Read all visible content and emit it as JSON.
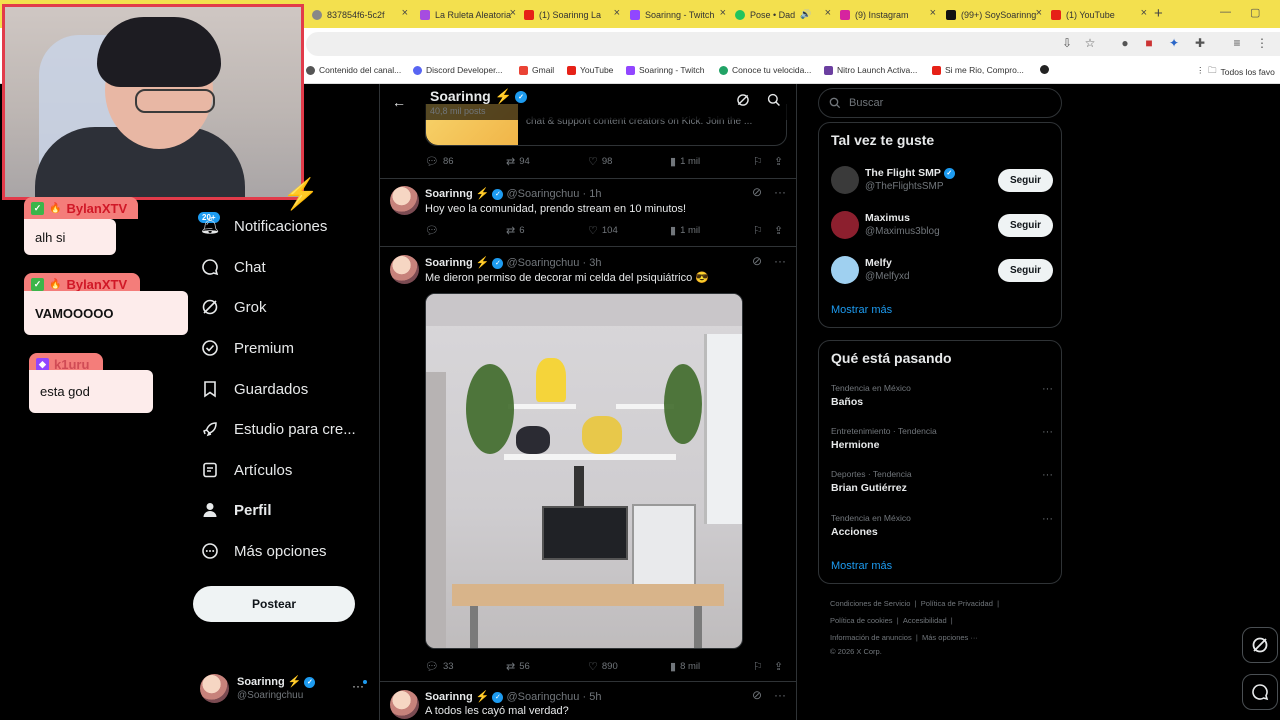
{
  "browser": {
    "tabs": [
      {
        "title": "837854f6-5c2f",
        "color": "#888"
      },
      {
        "title": "La Ruleta Aleatoria",
        "color": "#a64ce0"
      },
      {
        "title": "(1) Soarinng La",
        "color": "#e62117"
      },
      {
        "title": "Soarinng - Twitch",
        "color": "#9146ff"
      },
      {
        "title": "Pose • Dad",
        "color": "#21c45d"
      },
      {
        "title": "(9) Instagram",
        "color": "#d6249f"
      },
      {
        "title": "(99+) SoySoarinng",
        "color": "#111"
      },
      {
        "title": "(1) YouTube",
        "color": "#e62117"
      }
    ],
    "bookmarks": [
      {
        "label": "Contenido del canal...",
        "color": "#555"
      },
      {
        "label": "Discord Developer...",
        "color": "#5865f2"
      },
      {
        "label": "Gmail",
        "color": "#ea4335"
      },
      {
        "label": "YouTube",
        "color": "#e62117"
      },
      {
        "label": "Soarinng - Twitch",
        "color": "#9146ff"
      },
      {
        "label": "Conoce tu velocida...",
        "color": "#21a366"
      },
      {
        "label": "Nitro Launch Activa...",
        "color": "#6b3fa0"
      },
      {
        "label": "Si me Rio, Compro...",
        "color": "#e62117"
      },
      {
        "label": "",
        "color": "#222"
      }
    ],
    "all_bookmarks": "Todos los favo"
  },
  "chat": [
    {
      "user": "BylanXTV",
      "text": "alh si"
    },
    {
      "user": "BylanXTV",
      "text": "VAMOOOOO"
    },
    {
      "user": "k1uru",
      "text": "esta god"
    }
  ],
  "nav": {
    "badge": "20+",
    "items": [
      {
        "label": "Notificaciones",
        "icon": "bell-icon"
      },
      {
        "label": "Chat",
        "icon": "chat-icon"
      },
      {
        "label": "Grok",
        "icon": "grok-icon"
      },
      {
        "label": "Premium",
        "icon": "premium-icon"
      },
      {
        "label": "Guardados",
        "icon": "bookmark-icon"
      },
      {
        "label": "Estudio para cre...",
        "icon": "rocket-icon"
      },
      {
        "label": "Artículos",
        "icon": "articles-icon"
      },
      {
        "label": "Perfil",
        "icon": "person-icon"
      },
      {
        "label": "Más opciones",
        "icon": "more-circle-icon"
      }
    ],
    "post_button": "Postear",
    "account": {
      "name": "Soarinng ⚡",
      "handle": "@Soaringchuu"
    }
  },
  "timeline": {
    "header": {
      "name": "Soarinng ⚡",
      "posts": "40,8 mil posts"
    },
    "partial_card_text": "chat & support content creators on Kick. Join the ...",
    "partial_actions": {
      "replies": "86",
      "reposts": "94",
      "likes": "98",
      "views": "1 mil"
    },
    "tweets": [
      {
        "name": "Soarinng ⚡",
        "handle": "@Soaringchuu",
        "time": "· 1h",
        "text": "Hoy veo la comunidad, prendo stream en 10 minutos!",
        "replies": "",
        "reposts": "6",
        "likes": "104",
        "views": "1 mil"
      },
      {
        "name": "Soarinng ⚡",
        "handle": "@Soaringchuu",
        "time": "· 3h",
        "text": "Me dieron permiso de decorar mi celda del psiquiátrico 😎",
        "replies": "33",
        "reposts": "56",
        "likes": "890",
        "views": "8 mil"
      },
      {
        "name": "Soarinng ⚡",
        "handle": "@Soaringchuu",
        "time": "· 5h",
        "text": "A todos les cayó mal verdad?"
      }
    ]
  },
  "right": {
    "search_placeholder": "Buscar",
    "who_to_follow": {
      "title": "Tal vez te guste",
      "accounts": [
        {
          "name": "The Flight SMP",
          "handle": "@TheFlightsSMP",
          "verified": true,
          "avatar_color": "#3a3a3a"
        },
        {
          "name": "Maximus",
          "handle": "@Maximus3blog",
          "verified": false,
          "avatar_color": "#8c1f2e"
        },
        {
          "name": "Melfy",
          "handle": "@Melfyxd",
          "verified": false,
          "avatar_color": "#9fd0f0"
        }
      ],
      "follow_label": "Seguir",
      "show_more": "Mostrar más"
    },
    "trends": {
      "title": "Qué está pasando",
      "items": [
        {
          "context": "Tendencia en México",
          "topic": "Baños"
        },
        {
          "context": "Entretenimiento · Tendencia",
          "topic": "Hermione"
        },
        {
          "context": "Deportes · Tendencia",
          "topic": "Brian Gutiérrez"
        },
        {
          "context": "Tendencia en México",
          "topic": "Acciones"
        }
      ],
      "show_more": "Mostrar más"
    },
    "footer": {
      "line1": [
        "Condiciones de Servicio",
        "|",
        "Política de Privacidad",
        "|"
      ],
      "line2": [
        "Política de cookies",
        "|",
        "Accesibilidad",
        "|"
      ],
      "line3": [
        "Información de anuncios",
        "|",
        "Más opciones ···"
      ],
      "copyright": "© 2026 X Corp."
    }
  }
}
